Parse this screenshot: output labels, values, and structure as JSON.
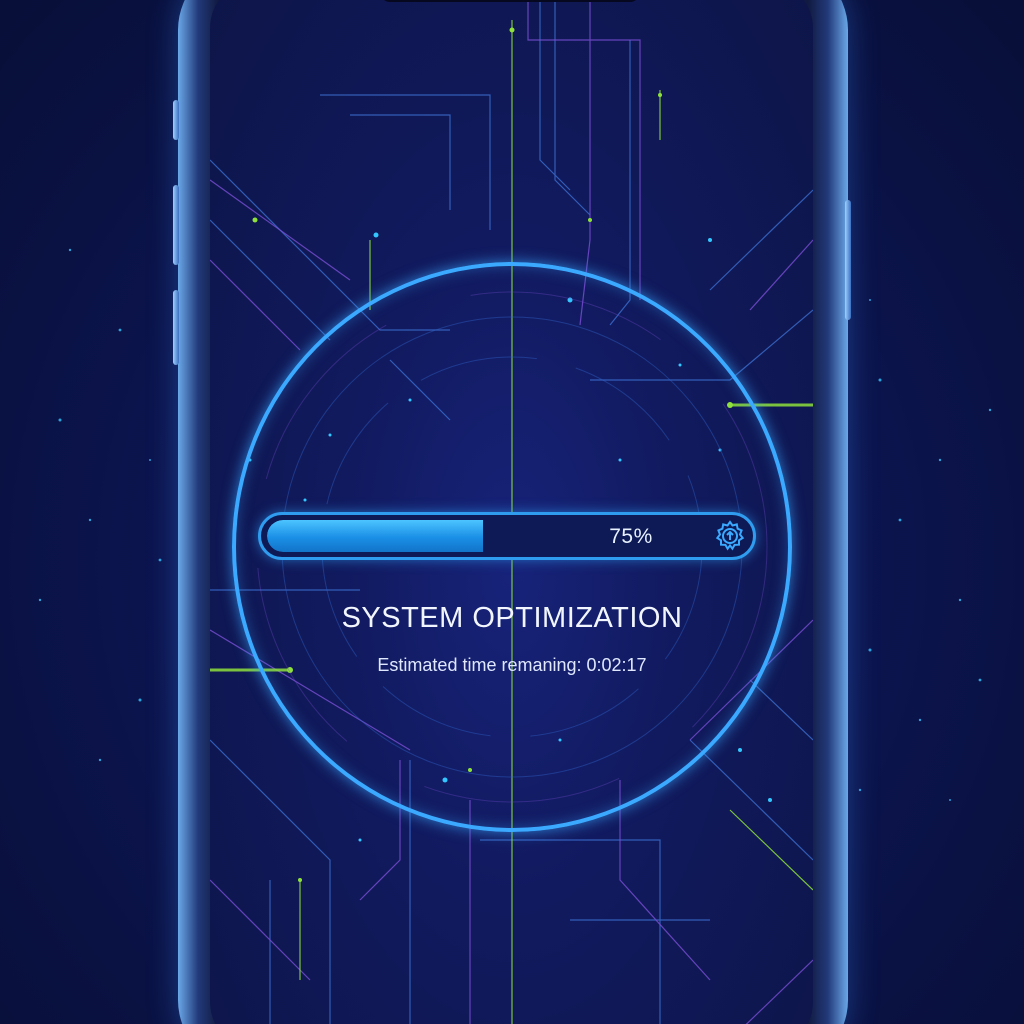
{
  "progress": {
    "value_percent": 75,
    "label": "75%"
  },
  "status": {
    "title": "SYSTEM OPTIMIZATION",
    "eta": "Estimated time remaning: 0:02:17"
  },
  "icons": {
    "progress_icon": "gear-upload-icon"
  },
  "colors": {
    "accent": "#3aa9ff",
    "progress_fill": "#1a8fe6",
    "circuit_green": "#8ee23b",
    "circuit_purple": "#7b4fd6",
    "background": "#0c1550"
  }
}
